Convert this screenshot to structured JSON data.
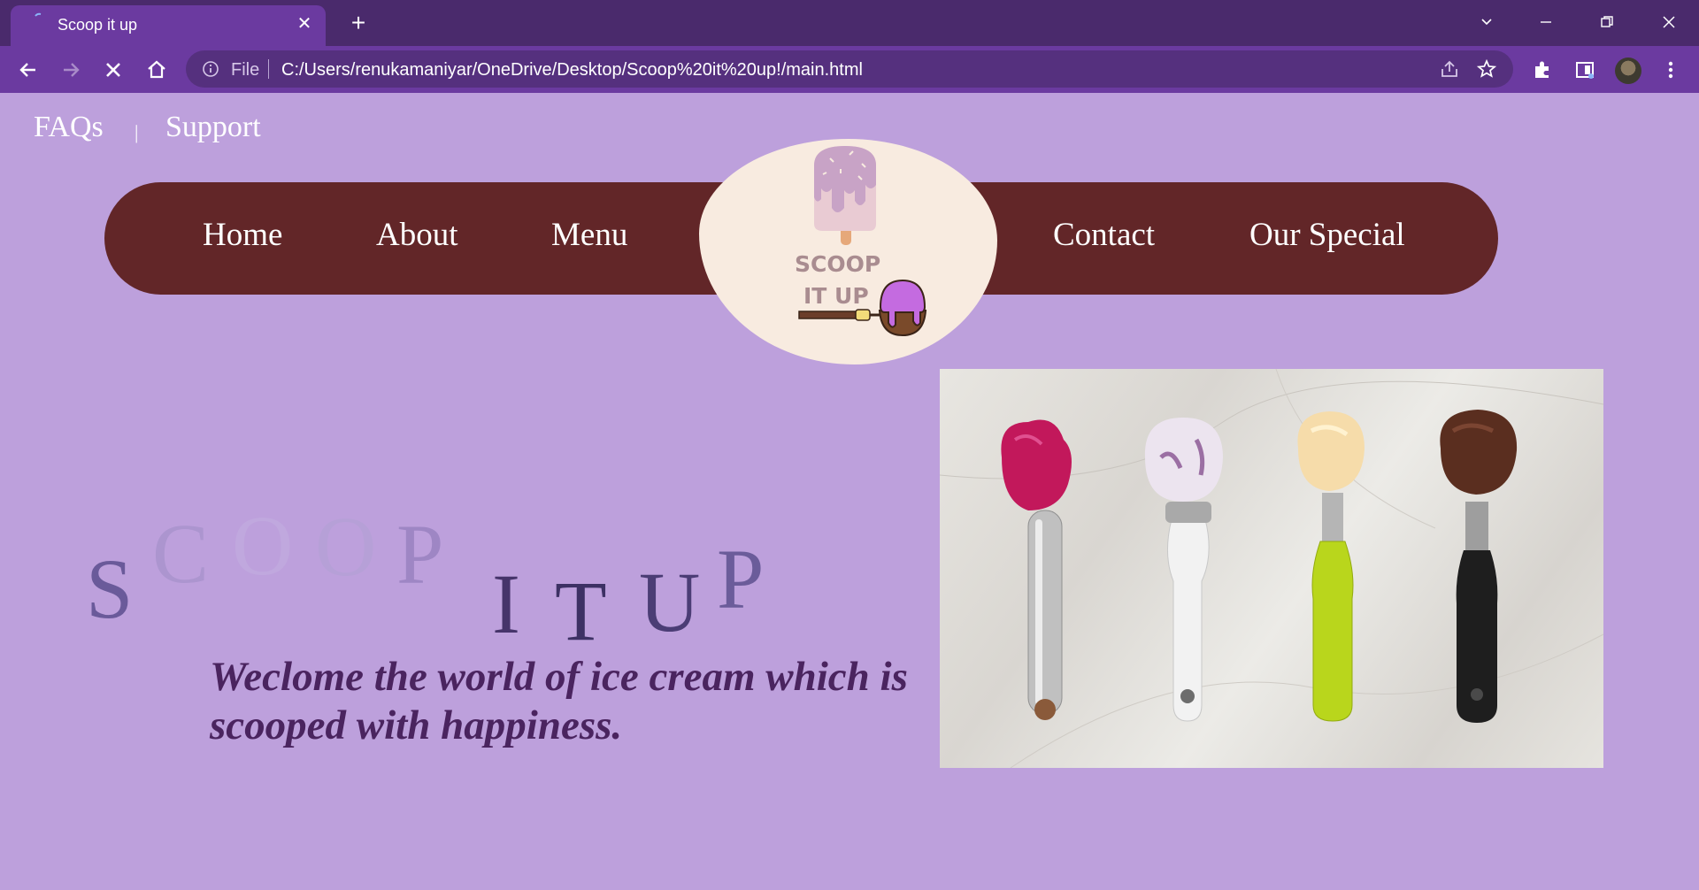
{
  "browser": {
    "tab_title": "Scoop it up",
    "address": {
      "scheme_label": "File",
      "url": "C:/Users/renukamaniyar/OneDrive/Desktop/Scoop%20it%20up!/main.html"
    }
  },
  "site": {
    "top_links": [
      "FAQs",
      "|",
      "Support"
    ],
    "nav": {
      "left": [
        "Home",
        "About",
        "Menu"
      ],
      "right": [
        "Contact",
        "Our Special"
      ]
    },
    "logo": {
      "line1": "SCOOP",
      "line2": "IT UP"
    },
    "hero": {
      "title_word1": [
        "S",
        "C",
        "O",
        "O",
        "P"
      ],
      "title_word2": [
        "I",
        "T",
        "U",
        "P"
      ],
      "tagline_line1": "Weclome the world of ice cream which is",
      "tagline_line2": "scooped with happiness."
    },
    "photo": {
      "scoops": [
        {
          "color": "#c2185b",
          "handle": "#bfbfbf"
        },
        {
          "color": "#ece4ef",
          "handle": "#f2f2f2"
        },
        {
          "color": "#f6dcaa",
          "handle": "#b9d61c"
        },
        {
          "color": "#5a2e1f",
          "handle": "#1e1e1e"
        }
      ]
    }
  },
  "colors": {
    "page_bg": "#bda0dc",
    "nav_bg": "#622628",
    "logo_bg": "#f8ebe0",
    "tagline": "#4a245f",
    "browser_frame": "#6b3aa0"
  }
}
